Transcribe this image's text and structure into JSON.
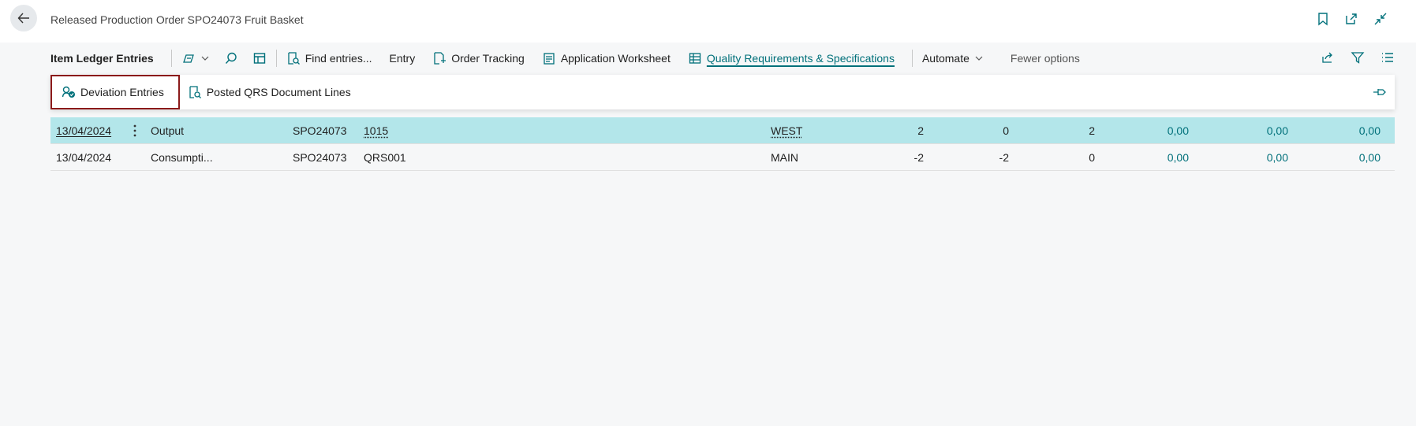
{
  "header": {
    "title": "Released Production Order SPO24073 Fruit Basket"
  },
  "actionbar": {
    "title": "Item Ledger Entries",
    "items": [
      {
        "label": "Find entries..."
      },
      {
        "label": "Entry"
      },
      {
        "label": "Order Tracking"
      },
      {
        "label": "Application Worksheet"
      },
      {
        "label": "Quality Requirements & Specifications"
      }
    ],
    "automate": "Automate",
    "fewer_options": "Fewer options"
  },
  "submenu": {
    "items": [
      {
        "label": "Deviation Entries"
      },
      {
        "label": "Posted QRS Document Lines"
      }
    ]
  },
  "table": {
    "rows": [
      {
        "date": "13/04/2024",
        "type": "Output",
        "doc": "SPO24073",
        "item": "1015",
        "location": "WEST",
        "q1": "2",
        "q2": "0",
        "q3": "2",
        "a1": "0,00",
        "a2": "0,00",
        "a3": "0,00"
      },
      {
        "date": "13/04/2024",
        "type": "Consumpti...",
        "doc": "SPO24073",
        "item": "QRS001",
        "location": "MAIN",
        "q1": "-2",
        "q2": "-2",
        "q3": "0",
        "a1": "0,00",
        "a2": "0,00",
        "a3": "0,00"
      }
    ]
  },
  "colors": {
    "accent": "#00707a",
    "selected_row": "#b3e6ea",
    "highlight_border": "#8b1a1a"
  }
}
